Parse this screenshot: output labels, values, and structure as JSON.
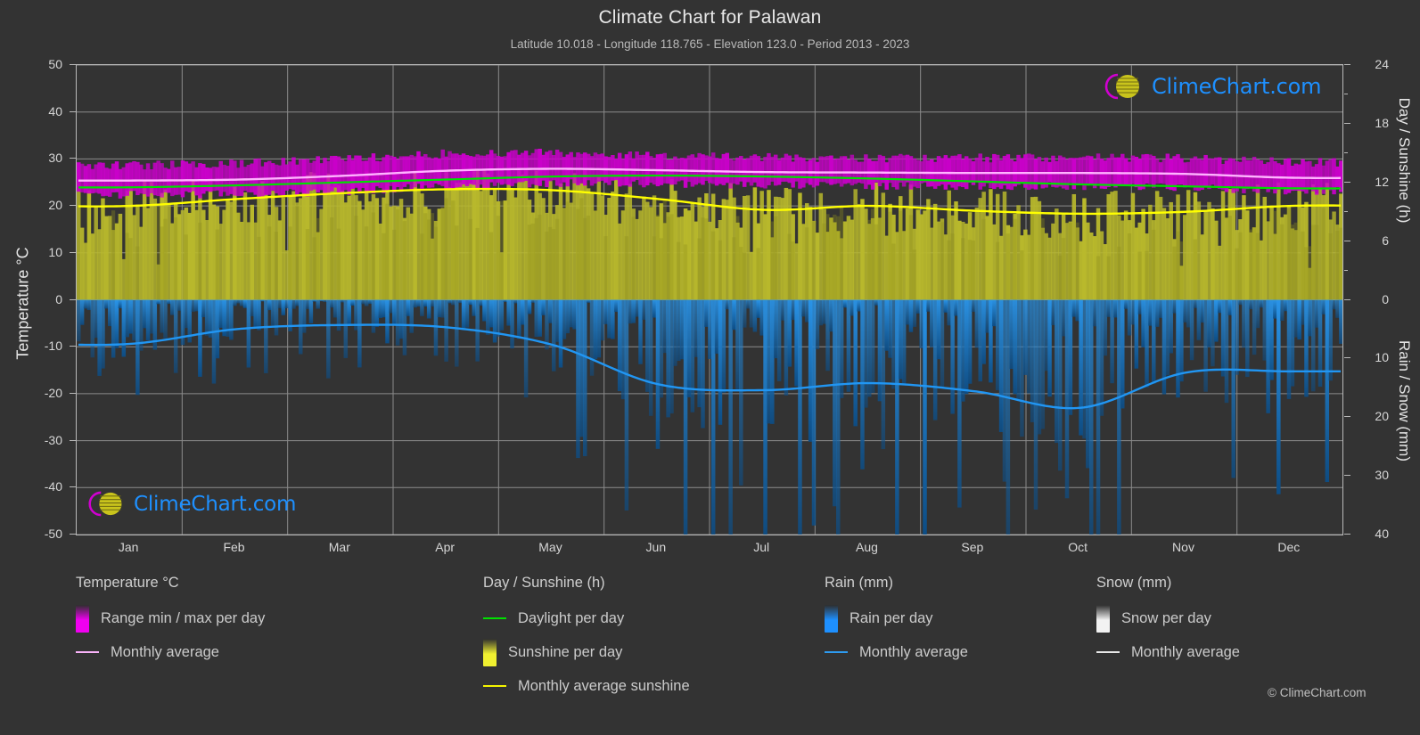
{
  "header": {
    "title": "Climate Chart for Palawan",
    "subtitle": "Latitude 10.018 - Longitude 118.765 - Elevation 123.0 - Period 2013 - 2023"
  },
  "axes": {
    "left_title": "Temperature °C",
    "left_ticks": [
      "50",
      "40",
      "30",
      "20",
      "10",
      "0",
      "-10",
      "-20",
      "-30",
      "-40",
      "-50"
    ],
    "right_title_top": "Day / Sunshine (h)",
    "right_title_bottom": "Rain / Snow (mm)",
    "right_ticks_top": [
      "24",
      "18",
      "12",
      "6",
      "0"
    ],
    "right_ticks_bottom": [
      "10",
      "20",
      "30",
      "40"
    ],
    "x_ticks": [
      "Jan",
      "Feb",
      "Mar",
      "Apr",
      "May",
      "Jun",
      "Jul",
      "Aug",
      "Sep",
      "Oct",
      "Nov",
      "Dec"
    ]
  },
  "logo": {
    "text": "ClimeChart.com"
  },
  "copyright": "© ClimeChart.com",
  "legend": {
    "columns": [
      {
        "heading": "Temperature °C",
        "items": [
          {
            "type": "box",
            "label": "Range min / max per day",
            "color": "#f000f0"
          },
          {
            "type": "line",
            "label": "Monthly average",
            "color": "#f9b3f9"
          }
        ]
      },
      {
        "heading": "Day / Sunshine (h)",
        "items": [
          {
            "type": "line",
            "label": "Daylight per day",
            "color": "#00e000"
          },
          {
            "type": "box",
            "label": "Sunshine per day",
            "color": "#f0f030"
          },
          {
            "type": "line",
            "label": "Monthly average sunshine",
            "color": "#f5f500"
          }
        ]
      },
      {
        "heading": "Rain (mm)",
        "items": [
          {
            "type": "box",
            "label": "Rain per day",
            "color": "#1e90ff"
          },
          {
            "type": "line",
            "label": "Monthly average",
            "color": "#2e9bf0"
          }
        ]
      },
      {
        "heading": "Snow (mm)",
        "items": [
          {
            "type": "box",
            "label": "Snow per day",
            "color": "#f2f2f2"
          },
          {
            "type": "line",
            "label": "Monthly average",
            "color": "#e8e8e8"
          }
        ]
      }
    ]
  },
  "colors": {
    "background": "#333333",
    "grid": "#8b8b8b",
    "frame": "#b9b9b9",
    "temp_range": "#cc00cc",
    "temp_avg": "#ffb3ff",
    "daylight": "#00e000",
    "sunshine_fill": "#a3a320",
    "sunshine_avg": "#ffff00",
    "rain_fill": "#1878c8",
    "rain_avg": "#2196f3",
    "text": "#d6d6d6"
  },
  "chart_data": {
    "type": "area",
    "title": "Climate Chart for Palawan",
    "subtitle": "Latitude 10.018 - Longitude 118.765 - Elevation 123.0 - Period 2013 - 2023",
    "xlabel": "",
    "ylabel": "Temperature °C",
    "ylim": [
      -50,
      50
    ],
    "y2lim_top": [
      0,
      24
    ],
    "y2lim_bottom": [
      0,
      40
    ],
    "grid": true,
    "legend_position": "below",
    "categories": [
      "Jan",
      "Feb",
      "Mar",
      "Apr",
      "May",
      "Jun",
      "Jul",
      "Aug",
      "Sep",
      "Oct",
      "Nov",
      "Dec"
    ],
    "series": [
      {
        "name": "Monthly average temperature (°C)",
        "unit": "°C",
        "color": "#ffb3ff",
        "values": [
          25.4,
          25.6,
          26.4,
          27.5,
          27.9,
          27.6,
          27.2,
          27.1,
          27.0,
          27.0,
          26.8,
          26.0
        ]
      },
      {
        "name": "Daily max temperature band top (°C)",
        "unit": "°C",
        "color": "#cc00cc",
        "values": [
          28.6,
          28.9,
          29.9,
          31.0,
          31.2,
          30.6,
          30.2,
          30.1,
          30.1,
          30.2,
          30.0,
          29.2
        ]
      },
      {
        "name": "Daily min temperature band bottom (°C)",
        "unit": "°C",
        "color": "#cc00cc",
        "values": [
          22.5,
          22.6,
          23.2,
          24.3,
          24.9,
          24.8,
          24.5,
          24.4,
          24.3,
          24.3,
          24.0,
          23.3
        ]
      },
      {
        "name": "Daylight per day (h)",
        "unit": "h",
        "color": "#00e000",
        "values": [
          11.5,
          11.7,
          12.0,
          12.3,
          12.6,
          12.7,
          12.6,
          12.4,
          12.1,
          11.8,
          11.6,
          11.4
        ]
      },
      {
        "name": "Monthly average sunshine (h)",
        "unit": "h",
        "color": "#ffff00",
        "values": [
          9.6,
          10.3,
          10.9,
          11.3,
          11.2,
          10.3,
          9.2,
          9.6,
          9.1,
          8.8,
          9.0,
          9.6
        ]
      },
      {
        "name": "Rain monthly average (mm)",
        "unit": "mm",
        "color": "#2196f3",
        "values": [
          7.5,
          5.0,
          4.3,
          4.7,
          7.7,
          14.4,
          15.4,
          14.2,
          15.6,
          18.4,
          12.4,
          12.2
        ]
      },
      {
        "name": "Snow monthly average (mm)",
        "unit": "mm",
        "color": "#e8e8e8",
        "values": [
          0,
          0,
          0,
          0,
          0,
          0,
          0,
          0,
          0,
          0,
          0,
          0
        ]
      }
    ]
  }
}
